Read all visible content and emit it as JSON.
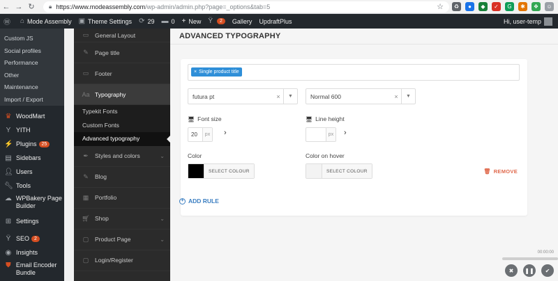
{
  "browser": {
    "url_host": "https://www.modeassembly.com",
    "url_path": "/wp-admin/admin.php?page=_options&tab=5"
  },
  "adminbar": {
    "site_name": "Mode Assembly",
    "theme_settings": "Theme Settings",
    "updates_count": "29",
    "comments_count": "0",
    "new_label": "New",
    "yoast_badge": "2",
    "gallery": "Gallery",
    "updraft": "UpdraftPlus",
    "greeting": "Hi, user-temp"
  },
  "wpmenu": {
    "sub_items": [
      "Custom JS",
      "Social profiles",
      "Performance",
      "Other",
      "Maintenance",
      "Import / Export"
    ],
    "items": [
      {
        "label": "WoodMart",
        "icon": "woodmart-icon"
      },
      {
        "label": "YITH",
        "icon": "yith-icon"
      },
      {
        "label": "Plugins",
        "icon": "plugins-icon",
        "badge": "25"
      },
      {
        "label": "Sidebars",
        "icon": "sidebars-icon"
      },
      {
        "label": "Users",
        "icon": "users-icon"
      },
      {
        "label": "Tools",
        "icon": "tools-icon"
      },
      {
        "label": "WPBakery Page Builder",
        "icon": "wpbakery-icon"
      },
      {
        "label": "Settings",
        "icon": "settings-icon"
      },
      {
        "label": "SEO",
        "icon": "seo-icon",
        "badge": "2"
      },
      {
        "label": "Insights",
        "icon": "insights-icon"
      },
      {
        "label": "Email Encoder Bundle",
        "icon": "email-encoder-icon"
      }
    ]
  },
  "tsmenu": {
    "before": [
      {
        "label": "General Layout",
        "icon": "layout-icon"
      },
      {
        "label": "Page title",
        "icon": "page-title-icon"
      },
      {
        "label": "Footer",
        "icon": "footer-icon"
      }
    ],
    "active": {
      "label": "Typography",
      "icon": "typography-icon"
    },
    "sub": [
      "Typekit Fonts",
      "Custom Fonts",
      "Advanced typography"
    ],
    "after": [
      {
        "label": "Styles and colors",
        "icon": "styles-icon",
        "chevron": true
      },
      {
        "label": "Blog",
        "icon": "blog-icon",
        "chevron": false
      },
      {
        "label": "Portfolio",
        "icon": "portfolio-icon",
        "chevron": false
      },
      {
        "label": "Shop",
        "icon": "shop-icon",
        "chevron": true
      },
      {
        "label": "Product Page",
        "icon": "product-page-icon",
        "chevron": true
      },
      {
        "label": "Login/Register",
        "icon": "login-icon",
        "chevron": false
      }
    ]
  },
  "main": {
    "title": "ADVANCED TYPOGRAPHY",
    "selector_tag": "Single product title",
    "font_family": "futura pt",
    "font_weight": "Normal 600",
    "font_size_label": "Font size",
    "font_size_value": "20",
    "font_size_unit": "px",
    "line_height_label": "Line height",
    "line_height_value": "",
    "line_height_unit": "px",
    "color_label": "Color",
    "color_hover_label": "Color on hover",
    "select_colour": "SELECT COLOUR",
    "color_value": "#000000",
    "color_hover_value": "#f3f3f3",
    "remove_label": "REMOVE",
    "add_rule_label": "ADD RULE"
  },
  "recorder": {
    "time": "00:00:00"
  }
}
